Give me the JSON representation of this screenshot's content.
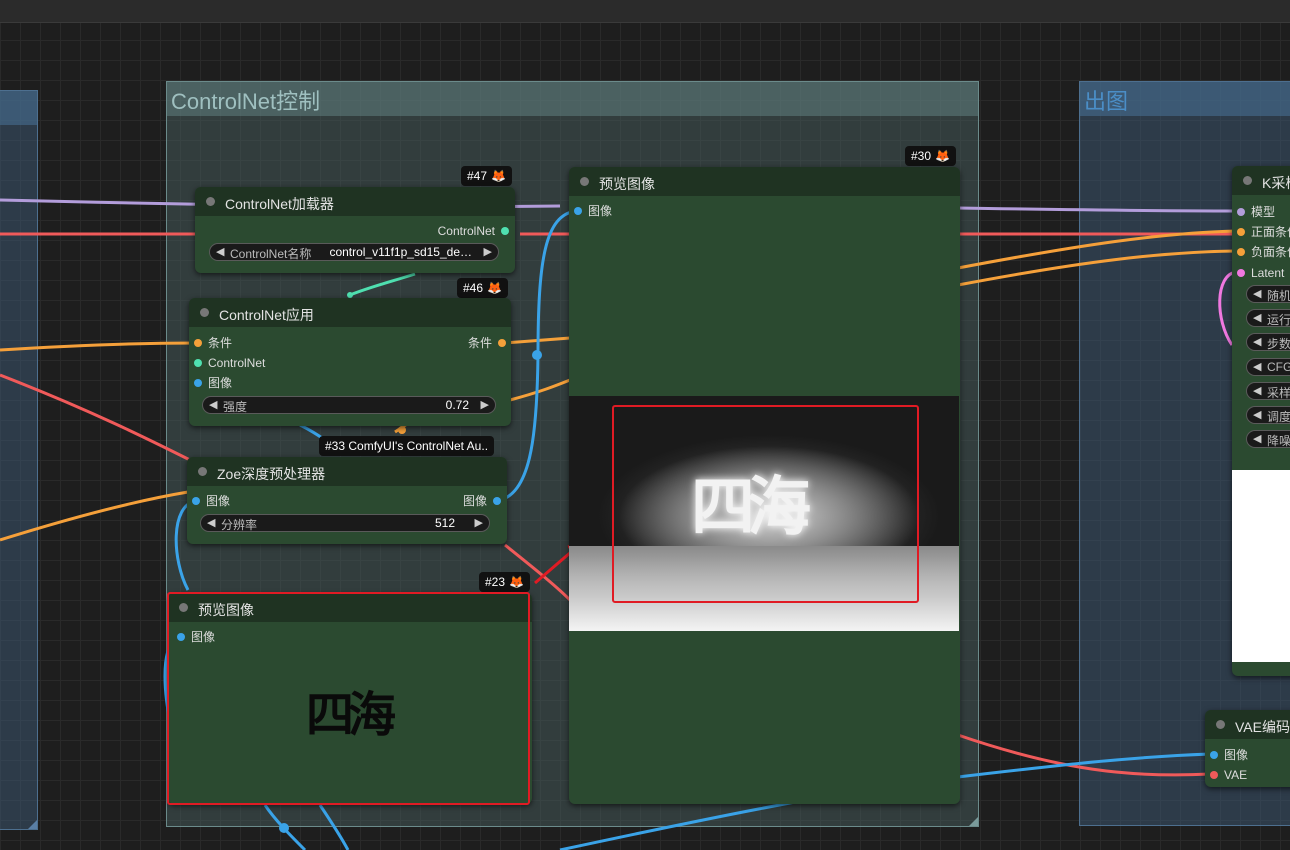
{
  "groups": {
    "controlnet": "ControlNet控制",
    "output": "出图"
  },
  "nodes": {
    "loader": {
      "badge": "#47",
      "title": "ControlNet加载器",
      "output": "ControlNet",
      "widget_label": "ControlNet名称",
      "widget_value": "control_v11f1p_sd15_de…"
    },
    "apply": {
      "badge": "#46",
      "title": "ControlNet应用",
      "in_cond": "条件",
      "in_cn": "ControlNet",
      "in_image": "图像",
      "out_cond": "条件",
      "widget_label": "强度",
      "widget_value": "0.72"
    },
    "zoe": {
      "badge": "#33 ComfyUI's ControlNet Au..",
      "title": "Zoe深度预处理器",
      "in_image": "图像",
      "out_image": "图像",
      "widget_label": "分辨率",
      "widget_value": "512"
    },
    "preview_small": {
      "badge": "#23",
      "title": "预览图像",
      "in_image": "图像",
      "image_text": "四海"
    },
    "preview_large": {
      "badge": "#30",
      "title": "预览图像",
      "in_image": "图像",
      "image_text": "四海"
    },
    "ksampler": {
      "title": "K采样器",
      "in_model": "模型",
      "in_pos": "正面条件",
      "in_neg": "负面条件",
      "in_latent": "Latent",
      "widgets": [
        "随机",
        "运行",
        "步数",
        "CFG",
        "采样",
        "调度",
        "降噪"
      ]
    },
    "vae_encode": {
      "title": "VAE编码",
      "in_image": "图像",
      "in_vae": "VAE"
    }
  },
  "icons": {
    "badge": "fox-icon"
  },
  "colors": {
    "image_wire": "#3aa3e8",
    "conditioning_wire": "#f5a03a",
    "controlnet_wire": "#4fe0b0",
    "vae_wire": "#f05a5a",
    "model_wire": "#b39ddb",
    "latent_wire": "#f078e0",
    "highlight": "#e01b24"
  }
}
